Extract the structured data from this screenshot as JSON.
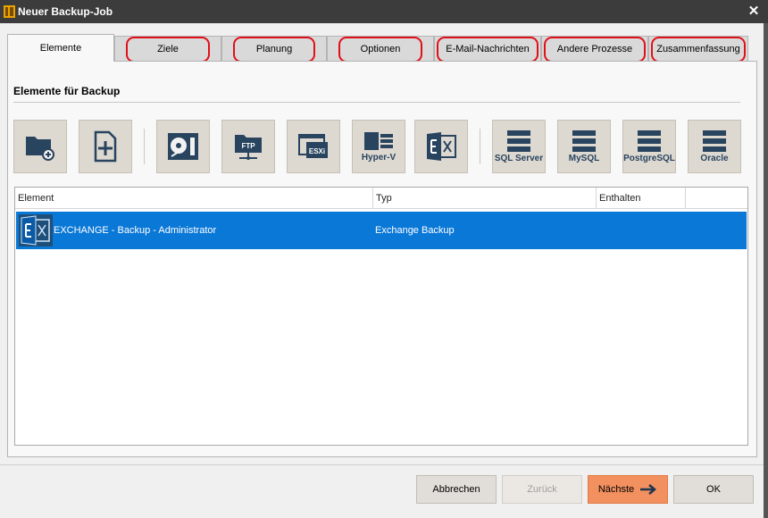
{
  "window": {
    "title": "Neuer Backup-Job",
    "close_glyph": "✕"
  },
  "tabs": [
    {
      "label": "Elemente",
      "active": true
    },
    {
      "label": "Ziele"
    },
    {
      "label": "Planung"
    },
    {
      "label": "Optionen"
    },
    {
      "label": "E-Mail-Nachrichten"
    },
    {
      "label": "Andere Prozesse"
    },
    {
      "label": "Zusammenfassung"
    }
  ],
  "section": {
    "title": "Elemente für Backup"
  },
  "toolbar": [
    {
      "icon": "add-folder-icon",
      "label": ""
    },
    {
      "icon": "add-file-icon",
      "label": ""
    },
    {
      "icon": "disk-image-icon",
      "label": ""
    },
    {
      "icon": "ftp-icon",
      "label": ""
    },
    {
      "icon": "esxi-icon",
      "label": ""
    },
    {
      "icon": "hyper-v-icon",
      "label": "Hyper-V"
    },
    {
      "icon": "exchange-icon",
      "label": ""
    },
    {
      "icon": "sql-server-icon",
      "label": "SQL Server"
    },
    {
      "icon": "mysql-icon",
      "label": "MySQL"
    },
    {
      "icon": "postgresql-icon",
      "label": "PostgreSQL"
    },
    {
      "icon": "oracle-icon",
      "label": "Oracle"
    }
  ],
  "icon_texts": {
    "ftp": "FTP",
    "esxi": "ESXi"
  },
  "list": {
    "columns": [
      "Element",
      "Typ",
      "Enthalten"
    ],
    "rows": [
      {
        "icon": "exchange-icon",
        "element": "EXCHANGE - Backup - Administrator",
        "type": "Exchange Backup",
        "included": ""
      }
    ]
  },
  "buttons": {
    "cancel": "Abbrechen",
    "back": "Zurück",
    "next": "Nächste",
    "ok": "OK"
  },
  "colors": {
    "accent_selection": "#0a78d7",
    "primary_button": "#f2905f",
    "highlight_ring": "#e0101a",
    "icon_navy": "#28445f"
  }
}
